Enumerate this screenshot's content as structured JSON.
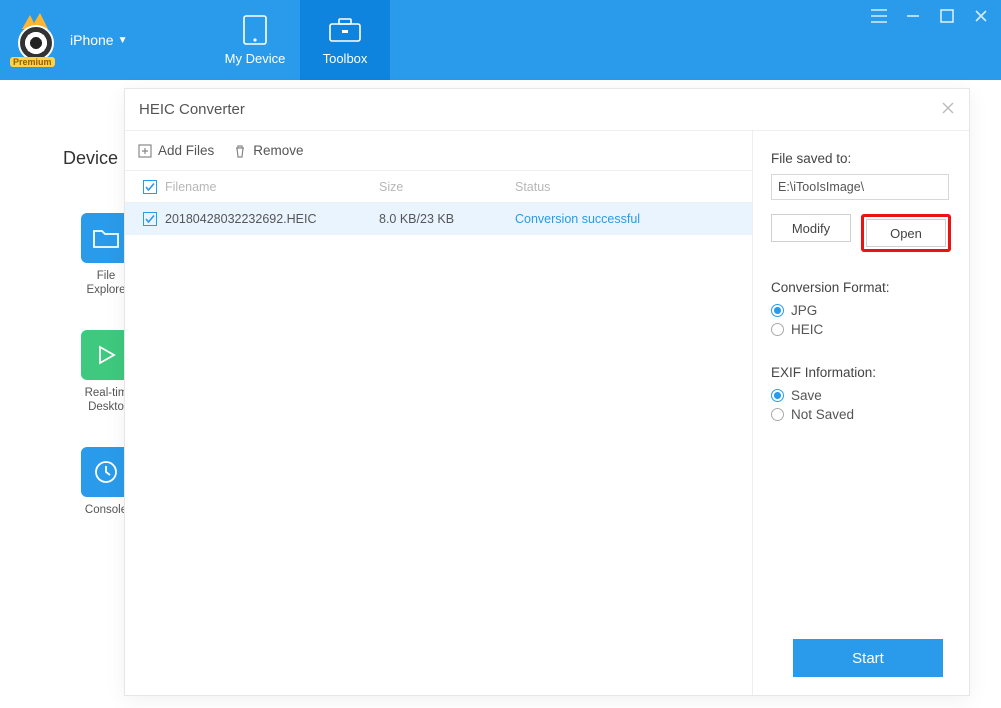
{
  "header": {
    "premium_badge": "Premium",
    "device_name": "iPhone",
    "tabs": {
      "my_device": "My Device",
      "toolbox": "Toolbox"
    }
  },
  "background": {
    "section_label": "Device",
    "tiles": {
      "file_explore": "File\nExplore",
      "realtime": "Real-tim\nDeskto",
      "console": "Console"
    }
  },
  "dialog": {
    "title": "HEIC Converter",
    "toolbar": {
      "add_files": "Add Files",
      "remove": "Remove"
    },
    "cols": {
      "filename": "Filename",
      "size": "Size",
      "status": "Status"
    },
    "rows": [
      {
        "name": "20180428032232692.HEIC",
        "size": "8.0 KB/23 KB",
        "status": "Conversion successful"
      }
    ],
    "right": {
      "saved_to_label": "File saved to:",
      "saved_to_path": "E:\\iTooIsImage\\",
      "modify": "Modify",
      "open": "Open",
      "format_label": "Conversion Format:",
      "format_options": {
        "jpg": "JPG",
        "heic": "HEIC"
      },
      "exif_label": "EXIF Information:",
      "exif_options": {
        "save": "Save",
        "not_saved": "Not Saved"
      },
      "start": "Start"
    }
  }
}
